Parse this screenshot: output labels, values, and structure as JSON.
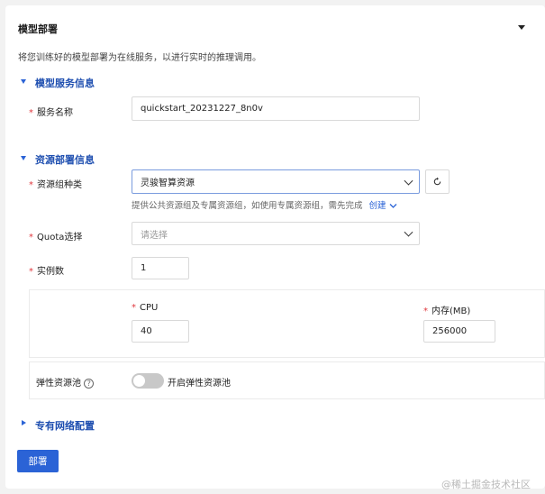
{
  "header": {
    "title": "模型部署",
    "collapse_icon": "caret-down-icon"
  },
  "description": "将您训练好的模型部署为在线服务，以进行实时的推理调用。",
  "sections": {
    "model_service": {
      "title": "模型服务信息",
      "service_name": {
        "label": "服务名称",
        "value": "quickstart_20231227_8n0v"
      }
    },
    "resource": {
      "title": "资源部署信息",
      "resource_group": {
        "label": "资源组种类",
        "value": "灵骏智算资源",
        "hint": "提供公共资源组及专属资源组，如使用专属资源组，需先完成",
        "create_link": "创建"
      },
      "quota": {
        "label": "Quota选择",
        "placeholder": "请选择"
      },
      "instances": {
        "label": "实例数",
        "value": "1"
      },
      "cpu": {
        "label": "CPU",
        "value": "40"
      },
      "memory": {
        "label": "内存(MB)",
        "value": "256000"
      },
      "elastic_pool": {
        "label": "弹性资源池",
        "toggle_label": "开启弹性资源池",
        "enabled": false
      }
    },
    "vpc": {
      "title": "专有网络配置"
    }
  },
  "deploy_button": "部署",
  "watermark": "@稀土掘金技术社区",
  "colors": {
    "accent": "#2b63d6",
    "required": "#e0383e"
  }
}
